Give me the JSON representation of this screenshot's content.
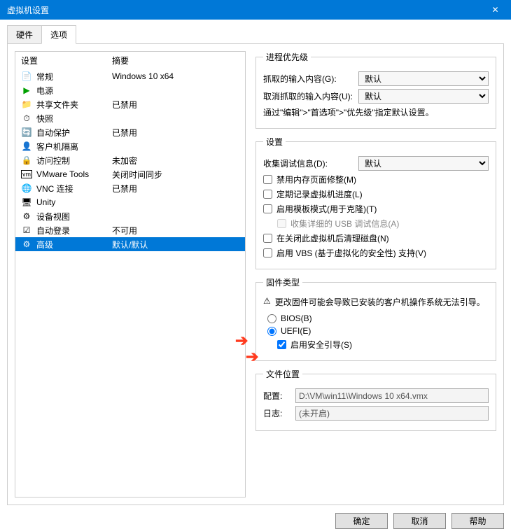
{
  "window": {
    "title": "虚拟机设置",
    "close": "✕"
  },
  "tabs": {
    "hardware": "硬件",
    "options": "选项"
  },
  "list": {
    "header": {
      "setting": "设置",
      "summary": "摘要"
    },
    "rows": [
      {
        "icon": "📄",
        "label": "常规",
        "summary": "Windows 10 x64"
      },
      {
        "icon": "▶",
        "iconColor": "#00a000",
        "label": "电源",
        "summary": ""
      },
      {
        "icon": "📁",
        "label": "共享文件夹",
        "summary": "已禁用"
      },
      {
        "icon": "⏱",
        "label": "快照",
        "summary": ""
      },
      {
        "icon": "🔄",
        "label": "自动保护",
        "summary": "已禁用"
      },
      {
        "icon": "👤",
        "label": "客户机隔离",
        "summary": ""
      },
      {
        "icon": "🔒",
        "label": "访问控制",
        "summary": "未加密"
      },
      {
        "icon": "vm",
        "label": "VMware Tools",
        "summary": "关闭时间同步"
      },
      {
        "icon": "🌐",
        "label": "VNC 连接",
        "summary": "已禁用"
      },
      {
        "icon": "🖥",
        "label": "Unity",
        "summary": ""
      },
      {
        "icon": "⚙",
        "label": "设备视图",
        "summary": ""
      },
      {
        "icon": "☑",
        "label": "自动登录",
        "summary": "不可用"
      },
      {
        "icon": "⚙",
        "label": "高级",
        "summary": "默认/默认",
        "selected": true
      }
    ]
  },
  "priority": {
    "legend": "进程优先级",
    "grab": "抓取的输入内容(G):",
    "ungrab": "取消抓取的输入内容(U):",
    "default": "默认",
    "hint": "通过\"编辑\">\"首选项\">\"优先级\"指定默认设置。"
  },
  "settings": {
    "legend": "设置",
    "debug": "收集调试信息(D):",
    "default": "默认",
    "mem": "禁用内存页面修整(M)",
    "log": "定期记录虚拟机进度(L)",
    "template": "启用模板模式(用于克隆)(T)",
    "usb": "收集详细的 USB 调试信息(A)",
    "clean": "在关闭此虚拟机后清理磁盘(N)",
    "vbs": "启用 VBS (基于虚拟化的安全性) 支持(V)"
  },
  "firmware": {
    "legend": "固件类型",
    "warn": "更改固件可能会导致已安装的客户机操作系统无法引导。",
    "bios": "BIOS(B)",
    "uefi": "UEFI(E)",
    "secure": "启用安全引导(S)"
  },
  "file": {
    "legend": "文件位置",
    "config": "配置:",
    "configPath": "D:\\VM\\win11\\Windows 10 x64.vmx",
    "log": "日志:",
    "logPath": "(未开启)"
  },
  "buttons": {
    "ok": "确定",
    "cancel": "取消",
    "help": "帮助"
  }
}
